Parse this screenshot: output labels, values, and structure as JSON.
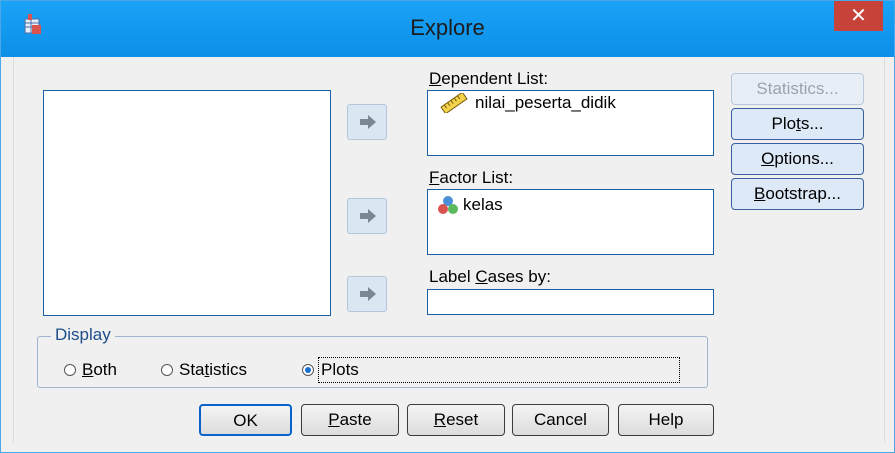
{
  "window": {
    "title": "Explore",
    "close_glyph": "✕"
  },
  "labels": {
    "dependent_prefix": "D",
    "dependent_rest": "ependent List:",
    "factor_prefix": "F",
    "factor_rest": "actor List:",
    "label_cases_a": "Label ",
    "label_cases_u": "C",
    "label_cases_b": "ases by:"
  },
  "dependent_list": {
    "items": [
      {
        "name": "nilai_peserta_didik",
        "icon": "ruler-icon"
      }
    ]
  },
  "factor_list": {
    "items": [
      {
        "name": "kelas",
        "icon": "nominal-variable-icon"
      }
    ]
  },
  "side_buttons": {
    "statistics": "Statistics...",
    "plots_a": "Plo",
    "plots_u": "t",
    "plots_b": "s...",
    "options_u": "O",
    "options_b": "ptions...",
    "bootstrap_u": "B",
    "bootstrap_b": "ootstrap..."
  },
  "display": {
    "legend": "Display",
    "both_u": "B",
    "both_b": "oth",
    "stats_a": "Sta",
    "stats_u": "t",
    "stats_b": "istics",
    "plots": "Plots",
    "selected": "Plots"
  },
  "buttons": {
    "ok": "OK",
    "paste_u": "P",
    "paste_b": "aste",
    "reset_u": "R",
    "reset_b": "eset",
    "cancel": "Cancel",
    "help": "Help"
  },
  "colors": {
    "title_bar": "#1aa3f7",
    "close": "#c7433a",
    "accent": "#1a6fd1"
  }
}
